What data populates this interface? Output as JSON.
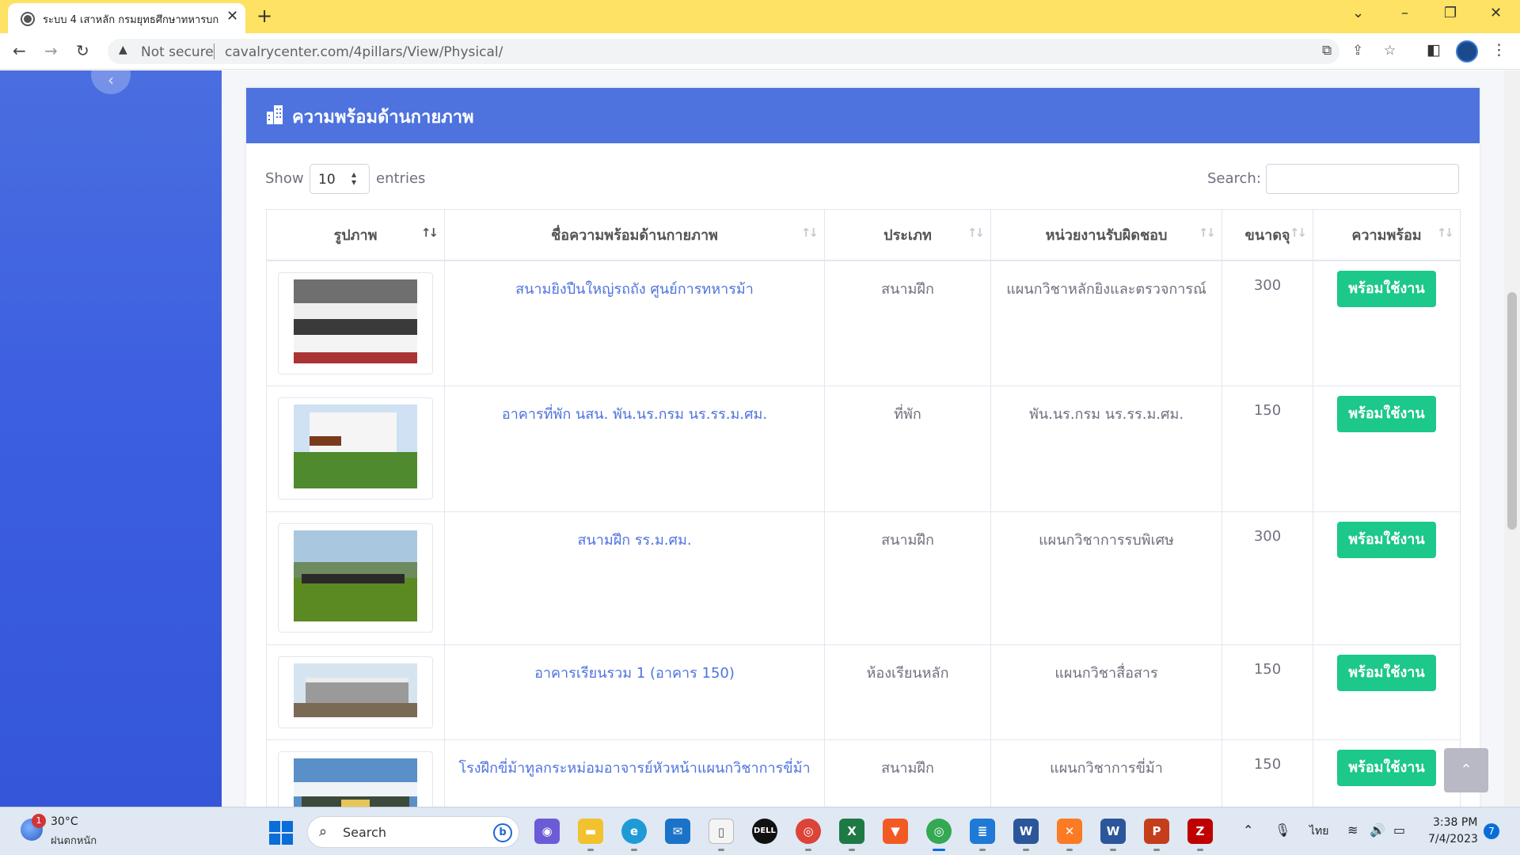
{
  "browser": {
    "tab_title": "ระบบ 4 เสาหลัก กรมยุทธศึกษาทหารบก",
    "tab_close": "✕",
    "new_tab": "+",
    "security_label": "Not secure",
    "url": "cavalrycenter.com/4pillars/View/Physical/"
  },
  "page": {
    "card_title": "ความพร้อมด้านกายภาพ",
    "accent_color": "#4e73df",
    "ready_color": "#1cc88a"
  },
  "datatable": {
    "show_label": "Show",
    "entries_value": "10",
    "entries_label": "entries",
    "search_label": "Search:",
    "search_value": "",
    "columns": [
      "รูปภาพ",
      "ชื่อความพร้อมด้านกายภาพ",
      "ประเภท",
      "หน่วยงานรับผิดชอบ",
      "ขนาดจุ",
      "ความพร้อม"
    ],
    "rows": [
      {
        "name": "สนามยิงปืนใหญ่รถถัง ศูนย์การทหารม้า",
        "type": "สนามฝึก",
        "unit": "แผนกวิชาหลักยิงและตรวจการณ์",
        "capacity": "300",
        "status": "พร้อมใช้งาน",
        "image": "stadium-photo"
      },
      {
        "name": "อาคารที่พัก นสน. พัน.นร.กรม นร.รร.ม.ศม.",
        "type": "ที่พัก",
        "unit": "พัน.นร.กรม นร.รร.ม.ศม.",
        "capacity": "150",
        "status": "พร้อมใช้งาน",
        "image": "dormitory-photo"
      },
      {
        "name": "สนามฝึก รร.ม.ศม.",
        "type": "สนามฝึก",
        "unit": "แผนกวิชาการรบพิเศษ",
        "capacity": "300",
        "status": "พร้อมใช้งาน",
        "image": "field-photo"
      },
      {
        "name": "อาคารเรียนรวม 1 (อาคาร 150)",
        "type": "ห้องเรียนหลัก",
        "unit": "แผนกวิชาสื่อสาร",
        "capacity": "150",
        "status": "พร้อมใช้งาน",
        "image": "building-photo"
      },
      {
        "name": "โรงฝึกขี่ม้าทูลกระหม่อมอาจารย์หัวหน้าแผนกวิชาการขี่ม้า",
        "type": "สนามฝึก",
        "unit": "แผนกวิชาการขี่ม้า",
        "capacity": "150",
        "status": "พร้อมใช้งาน",
        "image": "arena-photo"
      }
    ]
  },
  "taskbar": {
    "weather_badge": "1",
    "weather_temp": "30°C",
    "weather_desc": "ฝนตกหนัก",
    "search_placeholder": "Search",
    "language": "ไทย",
    "time": "3:38 PM",
    "date": "7/4/2023",
    "notification_count": "7",
    "apps": [
      "file-explorer-icon",
      "edge-icon",
      "mail-icon",
      "notepad-icon",
      "dell-icon",
      "chrome-icon",
      "excel-icon",
      "brave-icon",
      "chrome-profile-icon",
      "notes-icon",
      "word-icon",
      "xampp-icon",
      "word-alt-icon",
      "powerpoint-icon",
      "filezilla-icon"
    ]
  }
}
